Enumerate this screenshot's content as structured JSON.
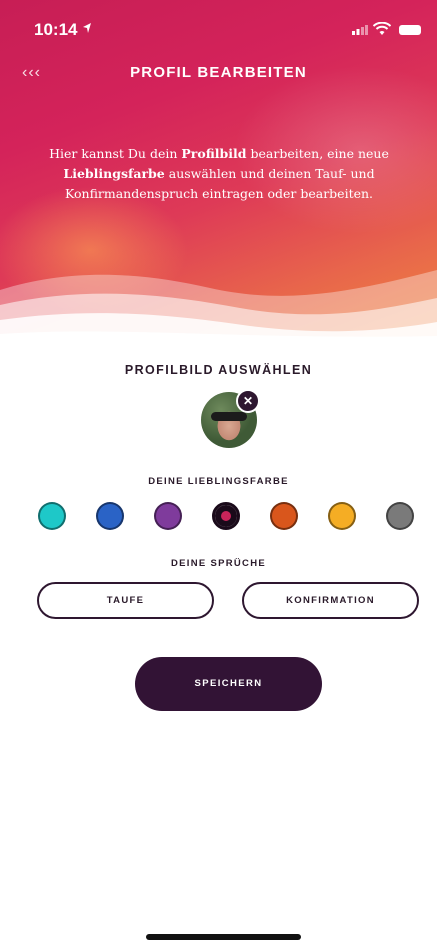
{
  "status_bar": {
    "time": "10:14"
  },
  "header": {
    "back_label": "‹‹‹",
    "title": "PROFIL BEARBEITEN"
  },
  "intro": {
    "p1": "Hier kannst Du dein ",
    "b1": "Profilbild",
    "p2": " bearbeiten, eine neue ",
    "b2": "Lieblingsfarbe",
    "p3": " auswählen und deinen Tauf- und Konfirmandenspruch eintragen oder bearbeiten."
  },
  "profile_picture": {
    "title": "PROFILBILD AUSWÄHLEN",
    "remove_symbol": "✕"
  },
  "favorite_color": {
    "title": "DEINE LIEBLINGSFARBE",
    "colors": [
      "#1ec8c8",
      "#2a63c6",
      "#7f3b9c",
      "#c9245a",
      "#d9561c",
      "#f5ad24",
      "#7a7a7a"
    ],
    "selected_index": 3
  },
  "sayings": {
    "title": "DEINE SPRÜCHE",
    "baptism_label": "TAUFE",
    "confirmation_label": "KONFIRMATION"
  },
  "save_label": "SPEICHERN"
}
